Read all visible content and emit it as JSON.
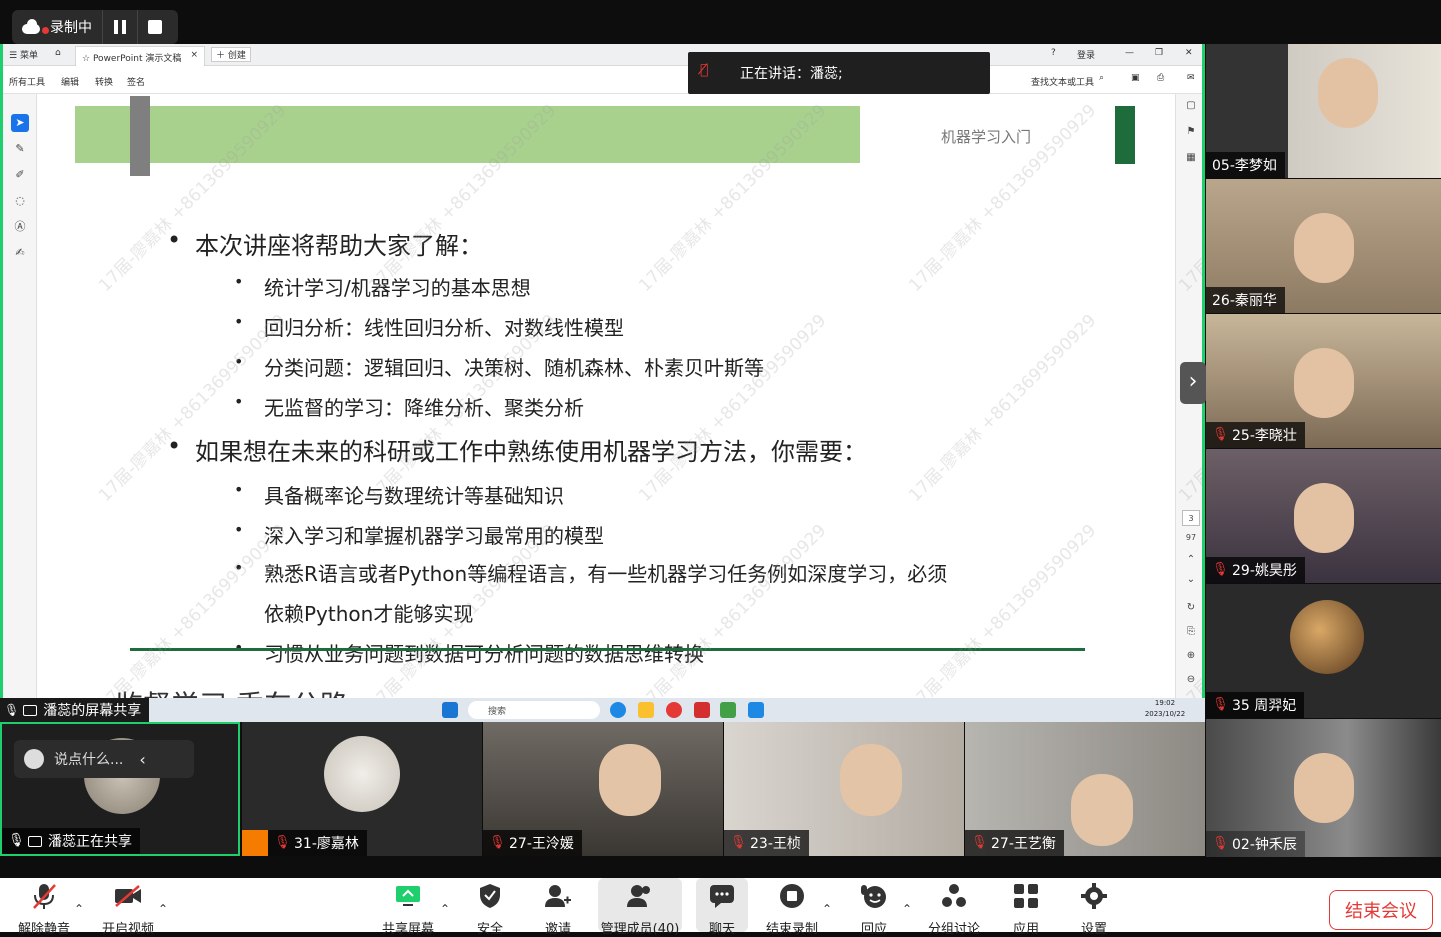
{
  "recording": {
    "label": "录制中"
  },
  "browser": {
    "menu_label": "菜单",
    "tab_title": "PowerPoint 演示文稿",
    "new_tab_label": "创建",
    "login_label": "登录",
    "tools": [
      "所有工具",
      "编辑",
      "转换",
      "签名"
    ],
    "find_label": "查找文本或工具"
  },
  "slide": {
    "header_text": "机器学习入门",
    "bullets": [
      {
        "level": 1,
        "text": "本次讲座将帮助大家了解："
      },
      {
        "level": 2,
        "text": "统计学习/机器学习的基本思想"
      },
      {
        "level": 2,
        "text": "回归分析：线性回归分析、对数线性模型"
      },
      {
        "level": 2,
        "text": "分类问题：逻辑回归、决策树、随机森林、朴素贝叶斯等"
      },
      {
        "level": 2,
        "text": "无监督的学习：降维分析、聚类分析"
      },
      {
        "level": 1,
        "text": "如果想在未来的科研或工作中熟练使用机器学习方法，你需要："
      },
      {
        "level": 2,
        "text": "具备概率论与数理统计等基础知识"
      },
      {
        "level": 2,
        "text": "深入学习和掌握机器学习最常用的模型"
      },
      {
        "level": 2,
        "text": "熟悉R语言或者Python等编程语言，有一些机器学习任务例如深度学习，必须"
      },
      {
        "level": 3,
        "text": "依赖Python才能够实现"
      },
      {
        "level": 2,
        "text": "习惯从业务问题到数据可分析问题的数据思维转换"
      }
    ],
    "next_title_fragment": "监督学习   乘车公路"
  },
  "speaking": {
    "text": "正在讲话：潘蕊;"
  },
  "watermark": "17届-廖嘉林 +8613699590929",
  "page_nav": {
    "page": "3",
    "total": "97"
  },
  "taskbar": {
    "search": "搜索",
    "time": "19:02",
    "date": "2023/10/22"
  },
  "share_label": "潘蕊的屏幕共享",
  "right_participants": [
    {
      "name": "05-李梦如",
      "muted": false
    },
    {
      "name": "26-秦丽华",
      "muted": false
    },
    {
      "name": "25-李晓壮",
      "muted": true
    },
    {
      "name": "29-姚昊彤",
      "muted": true
    },
    {
      "name": "35 周羿妃",
      "muted": true
    },
    {
      "name": "02-钟禾辰",
      "muted": true
    }
  ],
  "bottom_participants": [
    {
      "name": "潘蕊正在共享",
      "muted": false
    },
    {
      "name": "31-廖嘉林",
      "muted": true
    },
    {
      "name": "27-王泠媛",
      "muted": true
    },
    {
      "name": "23-王桢",
      "muted": true
    },
    {
      "name": "27-王艺衡",
      "muted": true
    }
  ],
  "chat_placeholder": "说点什么...",
  "toolbar": {
    "unmute": "解除静音",
    "start_video": "开启视频",
    "share_screen": "共享屏幕",
    "security": "安全",
    "invite": "邀请",
    "participants": "管理成员(40)",
    "chat": "聊天",
    "end_recording": "结束录制",
    "reactions": "回应",
    "breakout": "分组讨论",
    "apps": "应用",
    "settings": "设置",
    "end_meeting": "结束会议"
  },
  "colors": {
    "share_border": "#1fce6d",
    "slide_bar": "#a9d18e",
    "slide_accent": "#1e6b3c",
    "mute_red": "#e53935",
    "end_red": "#e53935"
  }
}
